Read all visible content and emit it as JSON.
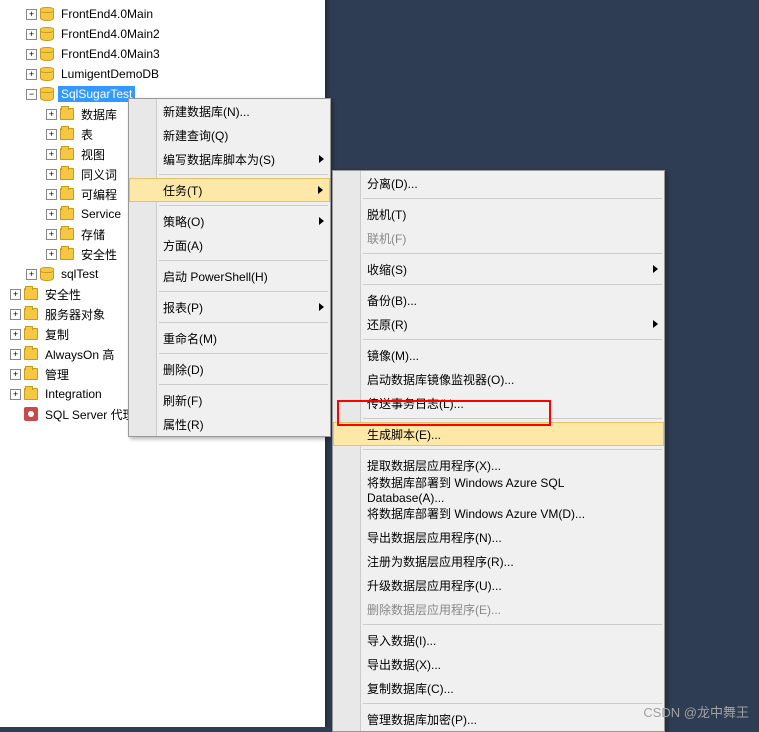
{
  "tree": {
    "items": [
      {
        "indent": 24,
        "exp": "+",
        "icon": "db",
        "label": "FrontEnd4.0Main"
      },
      {
        "indent": 24,
        "exp": "+",
        "icon": "db",
        "label": "FrontEnd4.0Main2"
      },
      {
        "indent": 24,
        "exp": "+",
        "icon": "db",
        "label": "FrontEnd4.0Main3"
      },
      {
        "indent": 24,
        "exp": "+",
        "icon": "db",
        "label": "LumigentDemoDB"
      },
      {
        "indent": 24,
        "exp": "−",
        "icon": "db",
        "label": "SqlSugarTest",
        "selected": true
      },
      {
        "indent": 44,
        "exp": "+",
        "icon": "folder",
        "label": "数据库"
      },
      {
        "indent": 44,
        "exp": "+",
        "icon": "folder",
        "label": "表"
      },
      {
        "indent": 44,
        "exp": "+",
        "icon": "folder",
        "label": "视图"
      },
      {
        "indent": 44,
        "exp": "+",
        "icon": "folder",
        "label": "同义词"
      },
      {
        "indent": 44,
        "exp": "+",
        "icon": "folder",
        "label": "可编程"
      },
      {
        "indent": 44,
        "exp": "+",
        "icon": "folder",
        "label": "Service"
      },
      {
        "indent": 44,
        "exp": "+",
        "icon": "folder",
        "label": "存储"
      },
      {
        "indent": 44,
        "exp": "+",
        "icon": "folder",
        "label": "安全性"
      },
      {
        "indent": 24,
        "exp": "+",
        "icon": "db",
        "label": "sqlTest"
      },
      {
        "indent": 8,
        "exp": "+",
        "icon": "folder",
        "label": "安全性"
      },
      {
        "indent": 8,
        "exp": "+",
        "icon": "folder",
        "label": "服务器对象"
      },
      {
        "indent": 8,
        "exp": "+",
        "icon": "folder",
        "label": "复制"
      },
      {
        "indent": 8,
        "exp": "+",
        "icon": "folder",
        "label": "AlwaysOn 高"
      },
      {
        "indent": 8,
        "exp": "+",
        "icon": "folder",
        "label": "管理"
      },
      {
        "indent": 8,
        "exp": "+",
        "icon": "folder",
        "label": "Integration"
      },
      {
        "indent": 8,
        "exp": "",
        "icon": "agent",
        "label": "SQL Server 代理"
      }
    ]
  },
  "menu1": {
    "items": [
      {
        "label": "新建数据库(N)..."
      },
      {
        "label": "新建查询(Q)"
      },
      {
        "label": "编写数据库脚本为(S)",
        "arrow": true
      },
      {
        "sep": true
      },
      {
        "label": "任务(T)",
        "arrow": true,
        "hover": true
      },
      {
        "sep": true
      },
      {
        "label": "策略(O)",
        "arrow": true
      },
      {
        "label": "方面(A)"
      },
      {
        "sep": true
      },
      {
        "label": "启动 PowerShell(H)"
      },
      {
        "sep": true
      },
      {
        "label": "报表(P)",
        "arrow": true
      },
      {
        "sep": true
      },
      {
        "label": "重命名(M)"
      },
      {
        "sep": true
      },
      {
        "label": "删除(D)"
      },
      {
        "sep": true
      },
      {
        "label": "刷新(F)"
      },
      {
        "label": "属性(R)"
      }
    ]
  },
  "menu2": {
    "items": [
      {
        "label": "分离(D)..."
      },
      {
        "sep": true
      },
      {
        "label": "脱机(T)"
      },
      {
        "label": "联机(F)",
        "disabled": true
      },
      {
        "sep": true
      },
      {
        "label": "收缩(S)",
        "arrow": true
      },
      {
        "sep": true
      },
      {
        "label": "备份(B)..."
      },
      {
        "label": "还原(R)",
        "arrow": true
      },
      {
        "sep": true
      },
      {
        "label": "镜像(M)..."
      },
      {
        "label": "启动数据库镜像监视器(O)..."
      },
      {
        "label": "传送事务日志(L)..."
      },
      {
        "sep": true
      },
      {
        "label": "生成脚本(E)...",
        "hover": true
      },
      {
        "sep": true
      },
      {
        "label": "提取数据层应用程序(X)..."
      },
      {
        "label": "将数据库部署到 Windows Azure SQL Database(A)..."
      },
      {
        "label": "将数据库部署到 Windows Azure VM(D)..."
      },
      {
        "label": "导出数据层应用程序(N)..."
      },
      {
        "label": "注册为数据层应用程序(R)..."
      },
      {
        "label": "升级数据层应用程序(U)..."
      },
      {
        "label": "删除数据层应用程序(E)...",
        "disabled": true
      },
      {
        "sep": true
      },
      {
        "label": "导入数据(I)..."
      },
      {
        "label": "导出数据(X)..."
      },
      {
        "label": "复制数据库(C)..."
      },
      {
        "sep": true
      },
      {
        "label": "管理数据库加密(P)..."
      }
    ]
  },
  "watermark": "CSDN @龙中舞王"
}
